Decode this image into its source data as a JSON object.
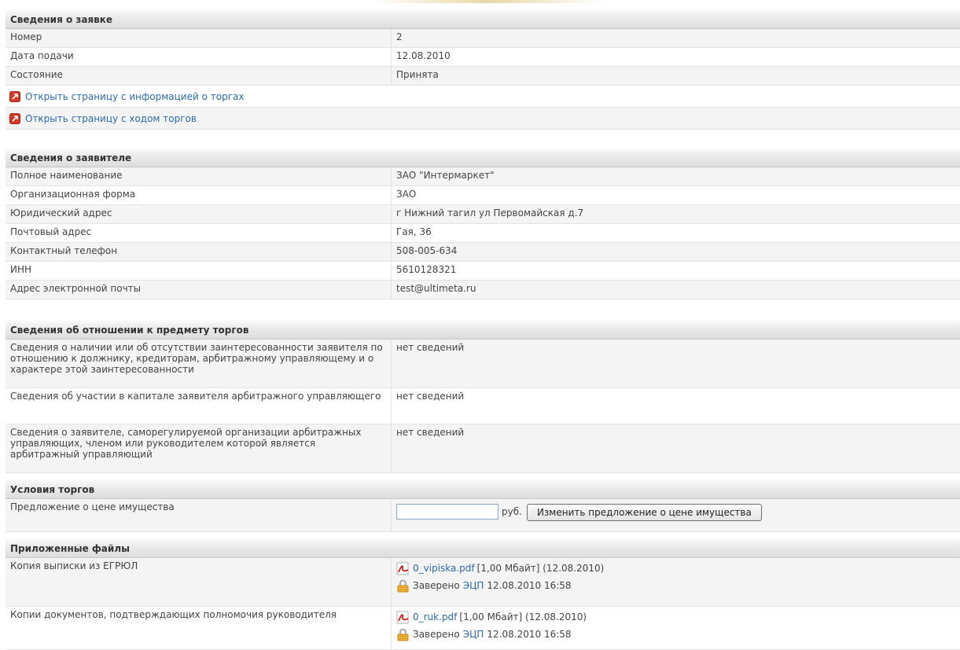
{
  "application": {
    "title": "Сведения о заявке",
    "rows": [
      {
        "label": "Номер",
        "value": "2"
      },
      {
        "label": "Дата подачи",
        "value": "12.08.2010"
      },
      {
        "label": "Состояние",
        "value": "Принята"
      }
    ],
    "links": [
      {
        "label": "Открыть страницу с информацией о торгах",
        "icon": "external-link-icon"
      },
      {
        "label": "Открыть страницу с ходом торгов",
        "icon": "external-link-icon"
      }
    ]
  },
  "applicant": {
    "title": "Сведения о заявителе",
    "rows": [
      {
        "label": "Полное наименование",
        "value": "ЗАО \"Интермаркет\""
      },
      {
        "label": "Организационная форма",
        "value": "ЗАО"
      },
      {
        "label": "Юридический адрес",
        "value": "г Нижний тагил ул Первомайская д.7"
      },
      {
        "label": "Почтовый адрес",
        "value": "Гая, 36"
      },
      {
        "label": "Контактный телефон",
        "value": "508-005-634"
      },
      {
        "label": "ИНН",
        "value": "5610128321"
      },
      {
        "label": "Адрес электронной почты",
        "value": "test@ultimeta.ru"
      }
    ]
  },
  "relation": {
    "title": "Сведения об отношении к предмету торгов",
    "rows": [
      {
        "label": "Сведения о наличии или об отсутствии заинтересованности заявителя по отношению к должнику, кредиторам, арбитражному управляющему и о характере этой заинтересованности",
        "value": "нет сведений"
      },
      {
        "label": "Сведения об участии в капитале заявителя арбитражного управляющего",
        "value": "нет сведений"
      },
      {
        "label": "Сведения о заявителе, саморегулируемой организации арбитражных управляющих, членом или руководителем которой является арбитражный управляющий",
        "value": "нет сведений"
      }
    ]
  },
  "terms": {
    "title": "Условия торгов",
    "price_label": "Предложение о цене имущества",
    "price_value": "",
    "currency": "руб.",
    "change_button": "Изменить предложение о цене имущества"
  },
  "files": {
    "title": "Приложенные файлы",
    "items": [
      {
        "label": "Копия выписки из ЕГРЮЛ",
        "file_name": "0_vipiska.pdf",
        "file_meta": "[1,00 Мбайт] (12.08.2010)",
        "signed_prefix": "Заверено",
        "signed_link": "ЭЦП",
        "signed_date": "12.08.2010 16:58",
        "file_icon": "pdf-icon",
        "lock_icon": "lock-icon"
      },
      {
        "label": "Копии документов, подтверждающих полномочия руководителя",
        "file_name": "0_ruk.pdf",
        "file_meta": "[1,00 Мбайт] (12.08.2010)",
        "signed_prefix": "Заверено",
        "signed_link": "ЭЦП",
        "signed_date": "12.08.2010 16:58",
        "file_icon": "pdf-icon",
        "lock_icon": "lock-icon"
      }
    ]
  },
  "colors": {
    "link": "#2e6aa8",
    "header_bg": "#dcdcdc",
    "row_alt": "#f4f4f4",
    "icon_red": "#d23b2a"
  }
}
